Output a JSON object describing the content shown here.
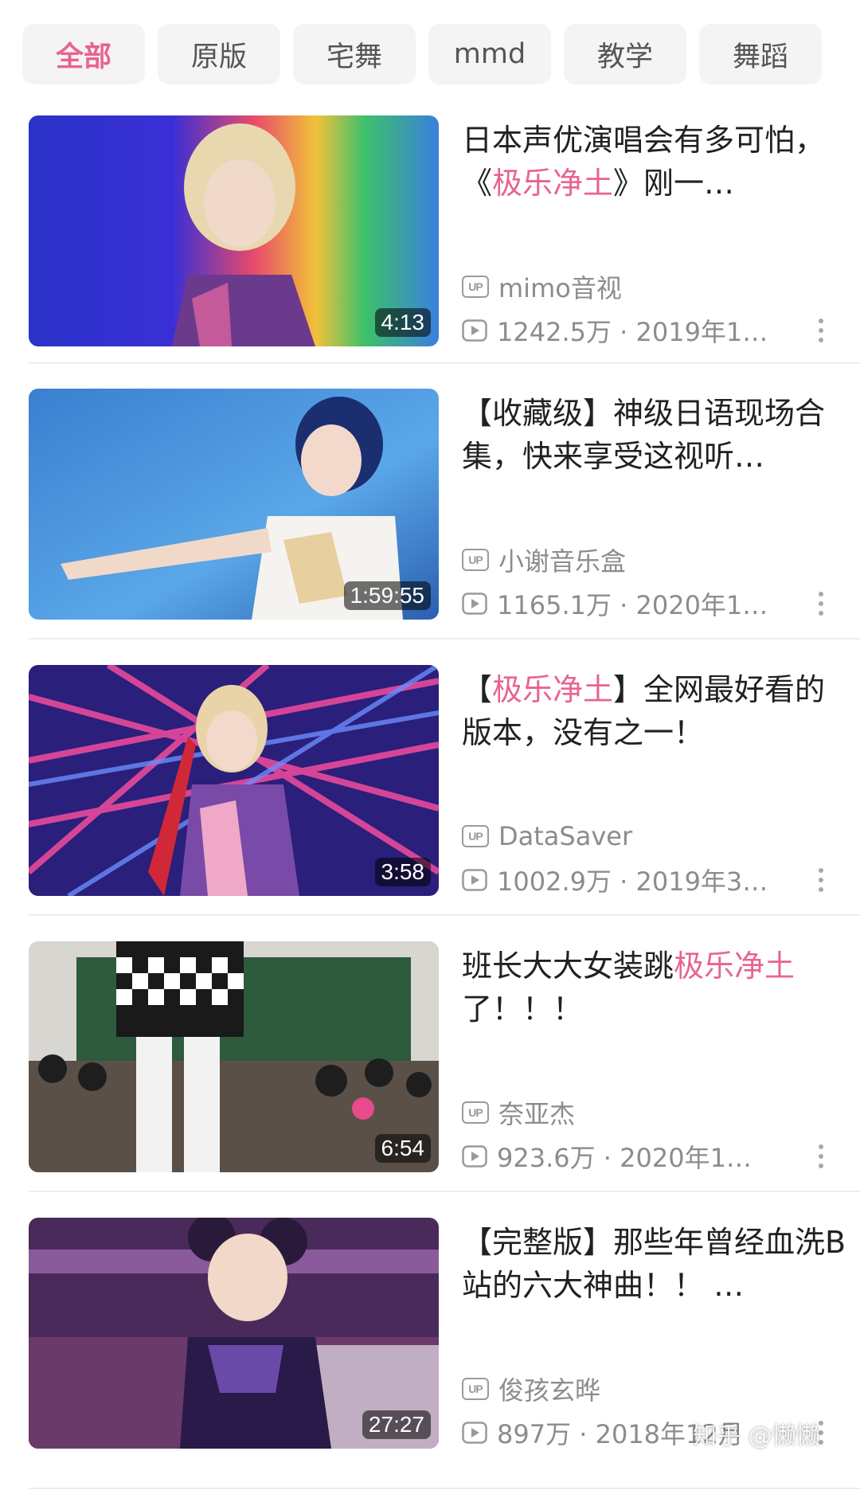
{
  "chips": [
    {
      "label": "全部",
      "active": true
    },
    {
      "label": "原版",
      "active": false
    },
    {
      "label": "宅舞",
      "active": false
    },
    {
      "label": "mmd",
      "active": false
    },
    {
      "label": "教学",
      "active": false
    },
    {
      "label": "舞蹈",
      "active": false
    }
  ],
  "videos": [
    {
      "title_parts": [
        {
          "text": "日本声优演唱会有多可怕，《",
          "hl": false
        },
        {
          "text": "极乐净土",
          "hl": true
        },
        {
          "text": "》刚一…",
          "hl": false
        }
      ],
      "duration": "4:13",
      "uploader": "mimo音视",
      "stats": "1242.5万 · 2019年1…"
    },
    {
      "title_parts": [
        {
          "text": "【收藏级】神级日语现场合集，快来享受这视听…",
          "hl": false
        }
      ],
      "duration": "1:59:55",
      "uploader": "小谢音乐盒",
      "stats": "1165.1万 · 2020年1…"
    },
    {
      "title_parts": [
        {
          "text": "【",
          "hl": false
        },
        {
          "text": "极乐净土",
          "hl": true
        },
        {
          "text": "】全网最好看的版本，没有之一！",
          "hl": false
        }
      ],
      "duration": "3:58",
      "uploader": "DataSaver",
      "stats": "1002.9万 · 2019年3…"
    },
    {
      "title_parts": [
        {
          "text": "班长大大女装跳",
          "hl": false
        },
        {
          "text": "极乐净土",
          "hl": true
        },
        {
          "text": "了！！！",
          "hl": false
        }
      ],
      "duration": "6:54",
      "uploader": "奈亚杰",
      "stats": "923.6万 · 2020年1…"
    },
    {
      "title_parts": [
        {
          "text": "【完整版】那些年曾经血洗B站的六大神曲！！ …",
          "hl": false
        }
      ],
      "duration": "27:27",
      "uploader": "俊孩玄晔",
      "stats": "897万 · 2018年12月"
    }
  ],
  "badge_label": "UP",
  "watermark": "知乎 @懒懒",
  "colors": {
    "accent": "#e8648f",
    "meta": "#8c8c8c",
    "chip_bg": "#f4f4f4"
  }
}
